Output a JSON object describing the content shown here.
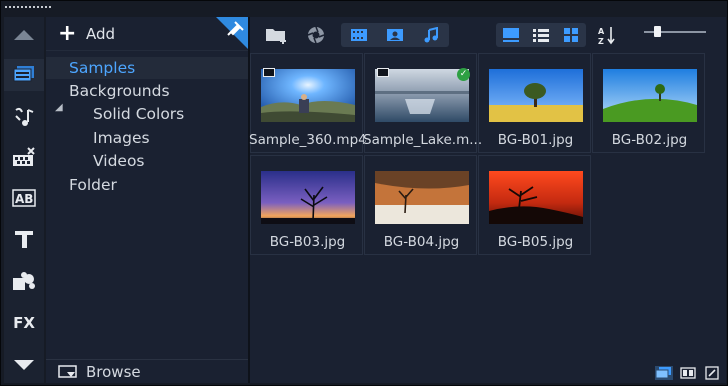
{
  "tree": {
    "add_label": "Add",
    "items": [
      {
        "label": "Samples",
        "selected": true
      },
      {
        "label": "Backgrounds"
      },
      {
        "label": "Solid Colors"
      },
      {
        "label": "Images"
      },
      {
        "label": "Videos"
      },
      {
        "label": "Folder"
      }
    ],
    "browse_label": "Browse"
  },
  "rail": {
    "titles_label": "AB",
    "fx_label": "FX"
  },
  "media": {
    "items": [
      {
        "name": "Sample_360.mp4",
        "icon": "film-icon"
      },
      {
        "name": "Sample_Lake.m...",
        "icon": "film-icon",
        "checked": true
      },
      {
        "name": "BG-B01.jpg"
      },
      {
        "name": "BG-B02.jpg"
      },
      {
        "name": "BG-B03.jpg"
      },
      {
        "name": "BG-B04.jpg"
      },
      {
        "name": "BG-B05.jpg"
      }
    ],
    "check_glyph": "✓"
  },
  "colors": {
    "accent": "#4da6ff",
    "panel": "#1a2131",
    "selected_bg": "#232b3a"
  }
}
